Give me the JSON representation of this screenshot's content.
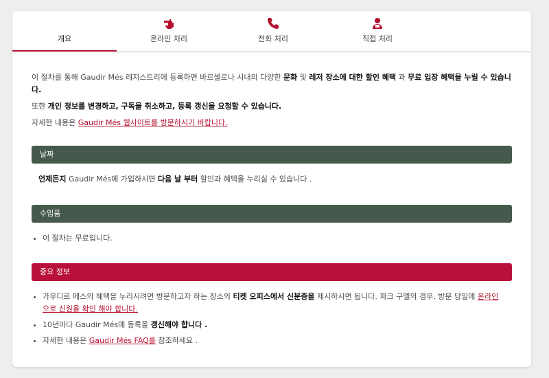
{
  "tabs": [
    {
      "label": "개요",
      "icon": "info",
      "active": true
    },
    {
      "label": "온라인 처리",
      "icon": "hand-pointer-icon"
    },
    {
      "label": "전화 처리",
      "icon": "phone-icon"
    },
    {
      "label": "직접 처리",
      "icon": "person-icon"
    }
  ],
  "intro": {
    "p1_a": "이 절차를 통해 Gaudir Més 레지스트리에 등록하면 바르셀로나 시내의 다양한 ",
    "p1_b1": "문화",
    "p1_c": " 및 ",
    "p1_b2": "레저 장소에 대한 할인 혜택",
    "p1_d": "  과 ",
    "p1_b3": "무료 입장 혜택을 누릴 수 있습니다.",
    "p2_a": "또한 ",
    "p2_b": "개인 정보를 변경하고, 구독을 취소하고, 등록 갱신을 요청할 수 있습니다.",
    "p3_a": "자세한 내용은 ",
    "p3_link": "Gaudir Més 웹사이트를 방문하시기 바랍니다."
  },
  "date_section": {
    "title": "날짜",
    "b1": "언제든지",
    "t1": " Gaudir Més에 가입하시면 ",
    "b2": "다음 날 부터",
    "t2": " 할인과 혜택을 누리실 수 있습니다 ."
  },
  "fee_section": {
    "title": "수입품",
    "item": "이 절차는 무료입니다."
  },
  "info_section": {
    "title": "중요 정보",
    "i1_a": "가우디르 메스의 혜택을 누리시려면 방문하고자 하는 장소의 ",
    "i1_b": "티켓 오피스에서 신분증을",
    "i1_c": " 제시하시면 됩니다. 파크 구엘의 경우, 방문 당일에 ",
    "i1_link": "온라인으로 신원을 확인 해야 합니다.",
    "i2_a": "10년마다 Gaudir Més에 등록을 ",
    "i2_b": "갱신해야 합니다 .",
    "i3_a": "자세한 내용은 ",
    "i3_link": "Gaudir Més FAQ를",
    "i3_c": " 참조하세요 ."
  },
  "colors": {
    "accent": "#b5102f",
    "section_green": "#455a4d",
    "section_red": "#b8103a"
  }
}
